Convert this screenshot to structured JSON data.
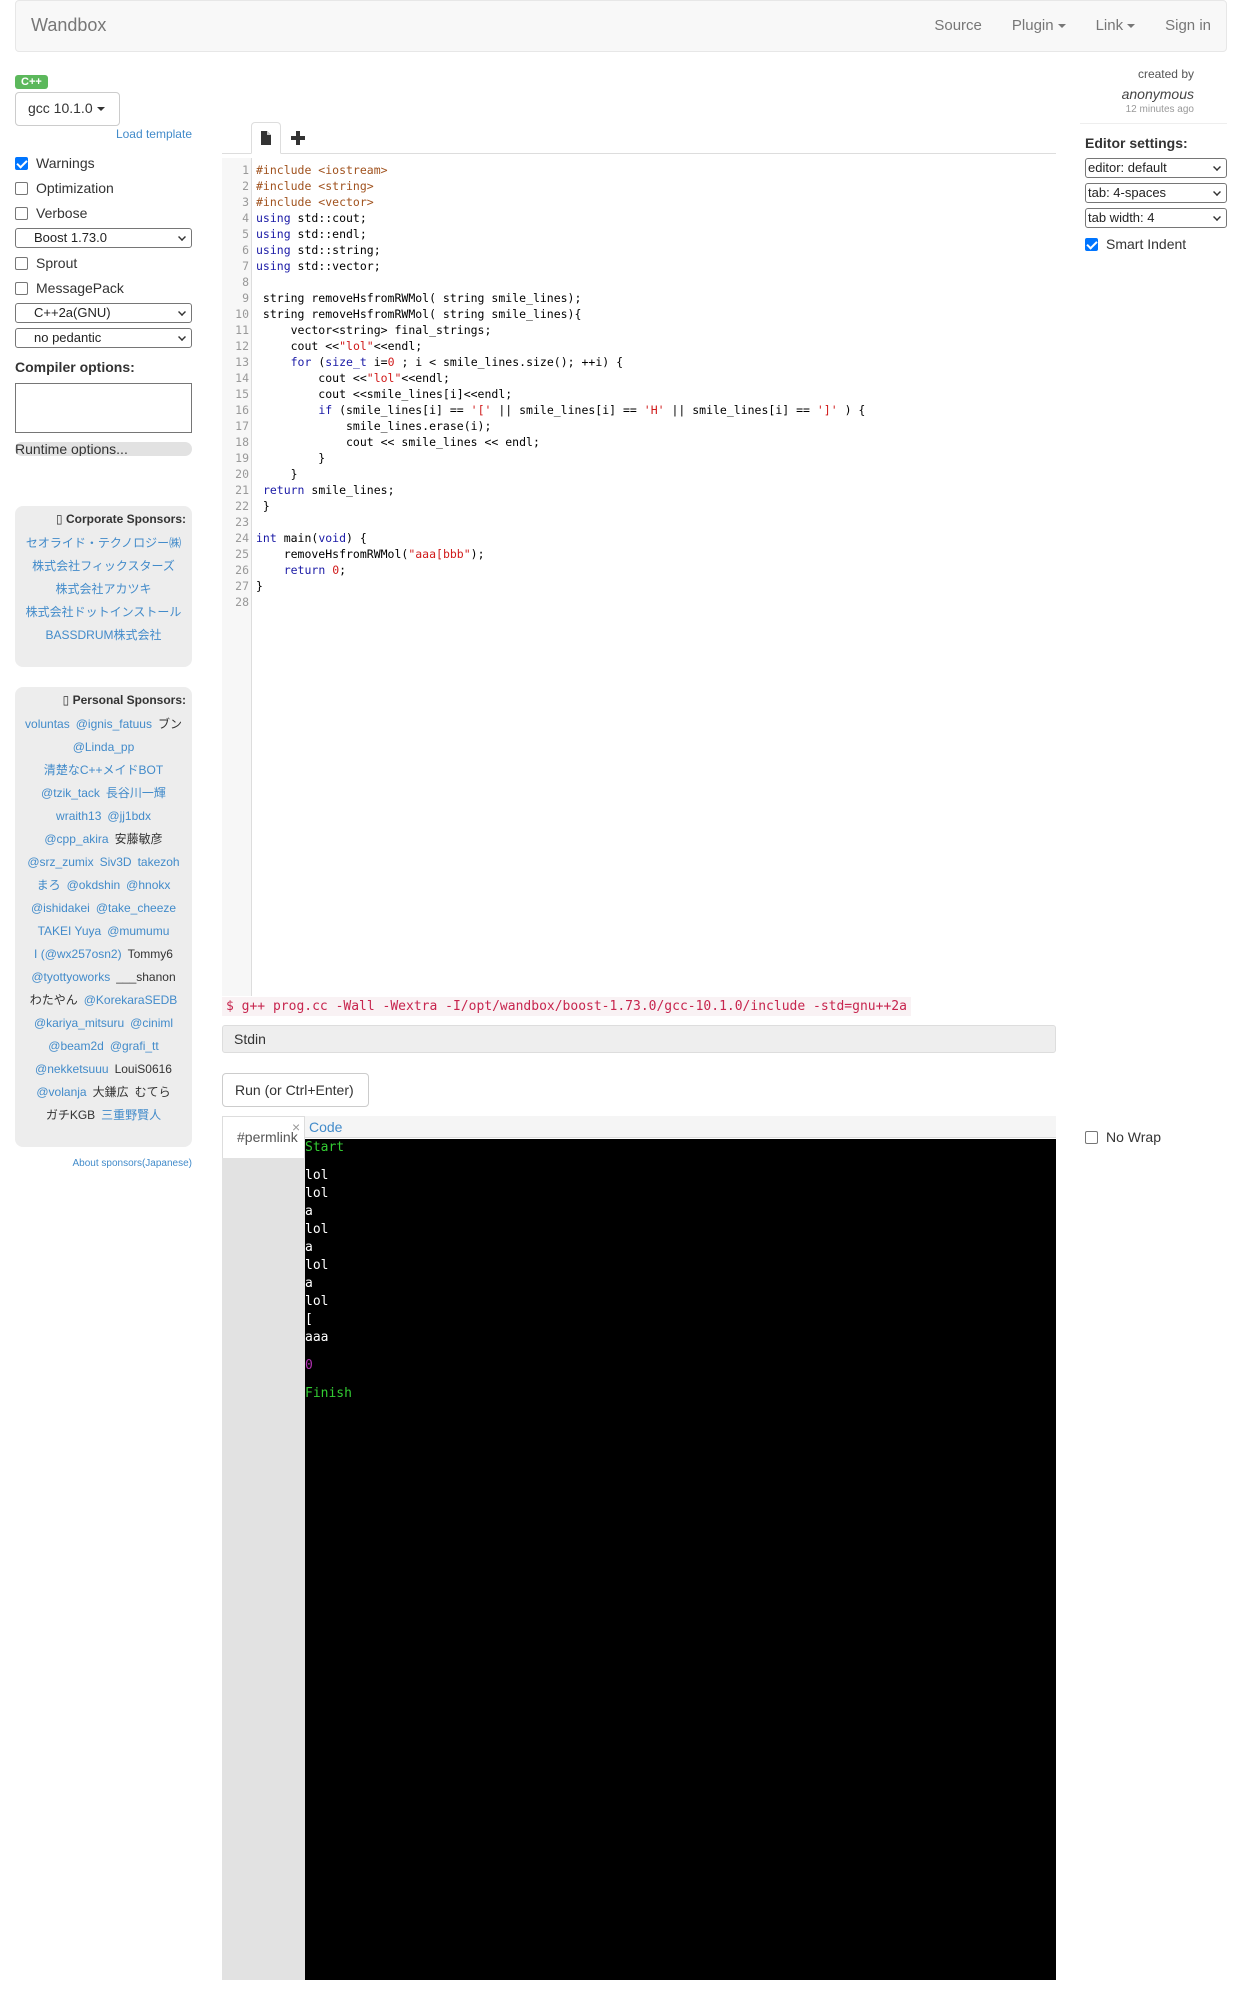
{
  "navbar": {
    "brand": "Wandbox",
    "source": "Source",
    "plugin": "Plugin",
    "link": "Link",
    "signin": "Sign in"
  },
  "compiler": {
    "language_badge": "C++",
    "selected": "gcc 10.1.0",
    "load_template": "Load template",
    "warnings": "Warnings",
    "optimization": "Optimization",
    "verbose": "Verbose",
    "boost": "Boost 1.73.0",
    "sprout": "Sprout",
    "messagepack": "MessagePack",
    "std": "C++2a(GNU)",
    "pedantic": "no pedantic",
    "compiler_options_label": "Compiler options:",
    "runtime_options_label": "Runtime options..."
  },
  "sponsors": {
    "corporate_title": "Corporate Sponsors:",
    "corporate": [
      "セオライド・テクノロジー㈱",
      "株式会社フィックスターズ",
      "株式会社アカツキ",
      "株式会社ドットインストール",
      "BASSDRUM株式会社"
    ],
    "personal_title": "Personal Sponsors:",
    "about": "About sponsors(Japanese)"
  },
  "personal_sponsors": [
    {
      "name": "voluntas",
      "link": true
    },
    {
      "name": "@ignis_fatuus",
      "link": true
    },
    {
      "name": "ブン",
      "link": false
    },
    {
      "name": "@Linda_pp",
      "link": true
    },
    {
      "name": "清楚なC++メイドBOT",
      "link": true
    },
    {
      "name": "@tzik_tack",
      "link": true
    },
    {
      "name": "長谷川一輝",
      "link": true
    },
    {
      "name": "wraith13",
      "link": true
    },
    {
      "name": "@jj1bdx",
      "link": true
    },
    {
      "name": "@cpp_akira",
      "link": true
    },
    {
      "name": "安藤敏彦",
      "link": false
    },
    {
      "name": "@srz_zumix",
      "link": true
    },
    {
      "name": "Siv3D",
      "link": true
    },
    {
      "name": "takezoh",
      "link": true
    },
    {
      "name": "まろ",
      "link": true
    },
    {
      "name": "@okdshin",
      "link": true
    },
    {
      "name": "@hnokx",
      "link": true
    },
    {
      "name": "@ishidakei",
      "link": true
    },
    {
      "name": "@take_cheeze",
      "link": true
    },
    {
      "name": "TAKEI Yuya",
      "link": true
    },
    {
      "name": "@mumumu",
      "link": true
    },
    {
      "name": "I (@wx257osn2)",
      "link": true
    },
    {
      "name": "Tommy6",
      "link": false
    },
    {
      "name": "@tyottyoworks",
      "link": true
    },
    {
      "name": "___shanon",
      "link": false
    },
    {
      "name": "わたやん",
      "link": false
    },
    {
      "name": "@KorekaraSEDB",
      "link": true
    },
    {
      "name": "@kariya_mitsuru",
      "link": true
    },
    {
      "name": "@ciniml",
      "link": true
    },
    {
      "name": "@beam2d",
      "link": true
    },
    {
      "name": "@grafi_tt",
      "link": true
    },
    {
      "name": "@nekketsuuu",
      "link": true
    },
    {
      "name": "LouiS0616",
      "link": false
    },
    {
      "name": "@volanja",
      "link": true
    },
    {
      "name": "大鎌広",
      "link": false
    },
    {
      "name": "むてら",
      "link": false
    },
    {
      "name": "ガチKGB",
      "link": false
    },
    {
      "name": "三重野賢人",
      "link": true
    }
  ],
  "editor": {
    "lines": [
      [
        {
          "t": "#include <iostream>",
          "c": "pre"
        }
      ],
      [
        {
          "t": "#include <string>",
          "c": "pre"
        }
      ],
      [
        {
          "t": "#include <vector>",
          "c": "pre"
        }
      ],
      [
        {
          "t": "using",
          "c": "kw"
        },
        {
          "t": " std::cout;",
          "c": ""
        }
      ],
      [
        {
          "t": "using",
          "c": "kw"
        },
        {
          "t": " std::endl;",
          "c": ""
        }
      ],
      [
        {
          "t": "using",
          "c": "kw"
        },
        {
          "t": " std::string;",
          "c": ""
        }
      ],
      [
        {
          "t": "using",
          "c": "kw"
        },
        {
          "t": " std::vector;",
          "c": ""
        }
      ],
      [
        {
          "t": "",
          "c": ""
        }
      ],
      [
        {
          "t": " string removeHsfromRWMol( string smile_lines);",
          "c": ""
        }
      ],
      [
        {
          "t": " string removeHsfromRWMol( string smile_lines){",
          "c": ""
        }
      ],
      [
        {
          "t": "     vector<string> final_strings;",
          "c": ""
        }
      ],
      [
        {
          "t": "     cout <<",
          "c": ""
        },
        {
          "t": "\"lol\"",
          "c": "str"
        },
        {
          "t": "<<endl;",
          "c": ""
        }
      ],
      [
        {
          "t": "     ",
          "c": ""
        },
        {
          "t": "for",
          "c": "kw"
        },
        {
          "t": " (",
          "c": ""
        },
        {
          "t": "size_t",
          "c": "type"
        },
        {
          "t": " i=",
          "c": ""
        },
        {
          "t": "0",
          "c": "num"
        },
        {
          "t": " ; i < smile_lines.size(); ++i) {",
          "c": ""
        }
      ],
      [
        {
          "t": "         cout <<",
          "c": ""
        },
        {
          "t": "\"lol\"",
          "c": "str"
        },
        {
          "t": "<<endl;",
          "c": ""
        }
      ],
      [
        {
          "t": "         cout <<smile_lines[i]<<endl;",
          "c": ""
        }
      ],
      [
        {
          "t": "         ",
          "c": ""
        },
        {
          "t": "if",
          "c": "kw"
        },
        {
          "t": " (smile_lines[i] == ",
          "c": ""
        },
        {
          "t": "'['",
          "c": "str"
        },
        {
          "t": " || smile_lines[i] == ",
          "c": ""
        },
        {
          "t": "'H'",
          "c": "str"
        },
        {
          "t": " || smile_lines[i] == ",
          "c": ""
        },
        {
          "t": "']'",
          "c": "str"
        },
        {
          "t": " ) {",
          "c": ""
        }
      ],
      [
        {
          "t": "             smile_lines.erase(i);",
          "c": ""
        }
      ],
      [
        {
          "t": "             cout << smile_lines << endl;",
          "c": ""
        }
      ],
      [
        {
          "t": "         }",
          "c": ""
        }
      ],
      [
        {
          "t": "     }",
          "c": ""
        }
      ],
      [
        {
          "t": " ",
          "c": ""
        },
        {
          "t": "return",
          "c": "kw"
        },
        {
          "t": " smile_lines;",
          "c": ""
        }
      ],
      [
        {
          "t": " }",
          "c": ""
        }
      ],
      [
        {
          "t": "",
          "c": ""
        }
      ],
      [
        {
          "t": "int",
          "c": "kw"
        },
        {
          "t": " main(",
          "c": ""
        },
        {
          "t": "void",
          "c": "kw"
        },
        {
          "t": ") {",
          "c": ""
        }
      ],
      [
        {
          "t": "    removeHsfromRWMol(",
          "c": ""
        },
        {
          "t": "\"aaa[bbb\"",
          "c": "str"
        },
        {
          "t": ");",
          "c": ""
        }
      ],
      [
        {
          "t": "    ",
          "c": ""
        },
        {
          "t": "return",
          "c": "kw"
        },
        {
          "t": " ",
          "c": ""
        },
        {
          "t": "0",
          "c": "num"
        },
        {
          "t": ";",
          "c": ""
        }
      ],
      [
        {
          "t": "}",
          "c": ""
        }
      ],
      [
        {
          "t": "",
          "c": ""
        }
      ]
    ]
  },
  "command_line": "$ g++ prog.cc -Wall -Wextra -I/opt/wandbox/boost-1.73.0/gcc-10.1.0/include -std=gnu++2a",
  "stdin_label": "Stdin",
  "run_button": "Run (or Ctrl+Enter)",
  "output": {
    "permlink": "#permlink",
    "close": "×",
    "code_tab": "Code",
    "lines": [
      {
        "text": "Start",
        "color": "green"
      },
      {
        "text": "",
        "color": "white"
      },
      {
        "text": "lol",
        "color": "white"
      },
      {
        "text": "lol",
        "color": "white"
      },
      {
        "text": "a",
        "color": "white"
      },
      {
        "text": "lol",
        "color": "white"
      },
      {
        "text": "a",
        "color": "white"
      },
      {
        "text": "lol",
        "color": "white"
      },
      {
        "text": "a",
        "color": "white"
      },
      {
        "text": "lol",
        "color": "white"
      },
      {
        "text": "[",
        "color": "white"
      },
      {
        "text": "aaa",
        "color": "white"
      },
      {
        "text": "",
        "color": "white"
      },
      {
        "text": "0",
        "color": "magenta"
      },
      {
        "text": "",
        "color": "white"
      },
      {
        "text": "Finish",
        "color": "green"
      }
    ]
  },
  "meta": {
    "created_by": "created by",
    "author": "anonymous",
    "time_ago": "12 minutes ago"
  },
  "editor_settings": {
    "title": "Editor settings:",
    "editor": "editor: default",
    "tab": "tab: 4-spaces",
    "tab_width": "tab width: 4",
    "smart_indent": "Smart Indent",
    "no_wrap": "No Wrap"
  },
  "colors": {
    "accent": "#428bca",
    "badge": "#5cb85c",
    "console_bg": "#000000"
  }
}
